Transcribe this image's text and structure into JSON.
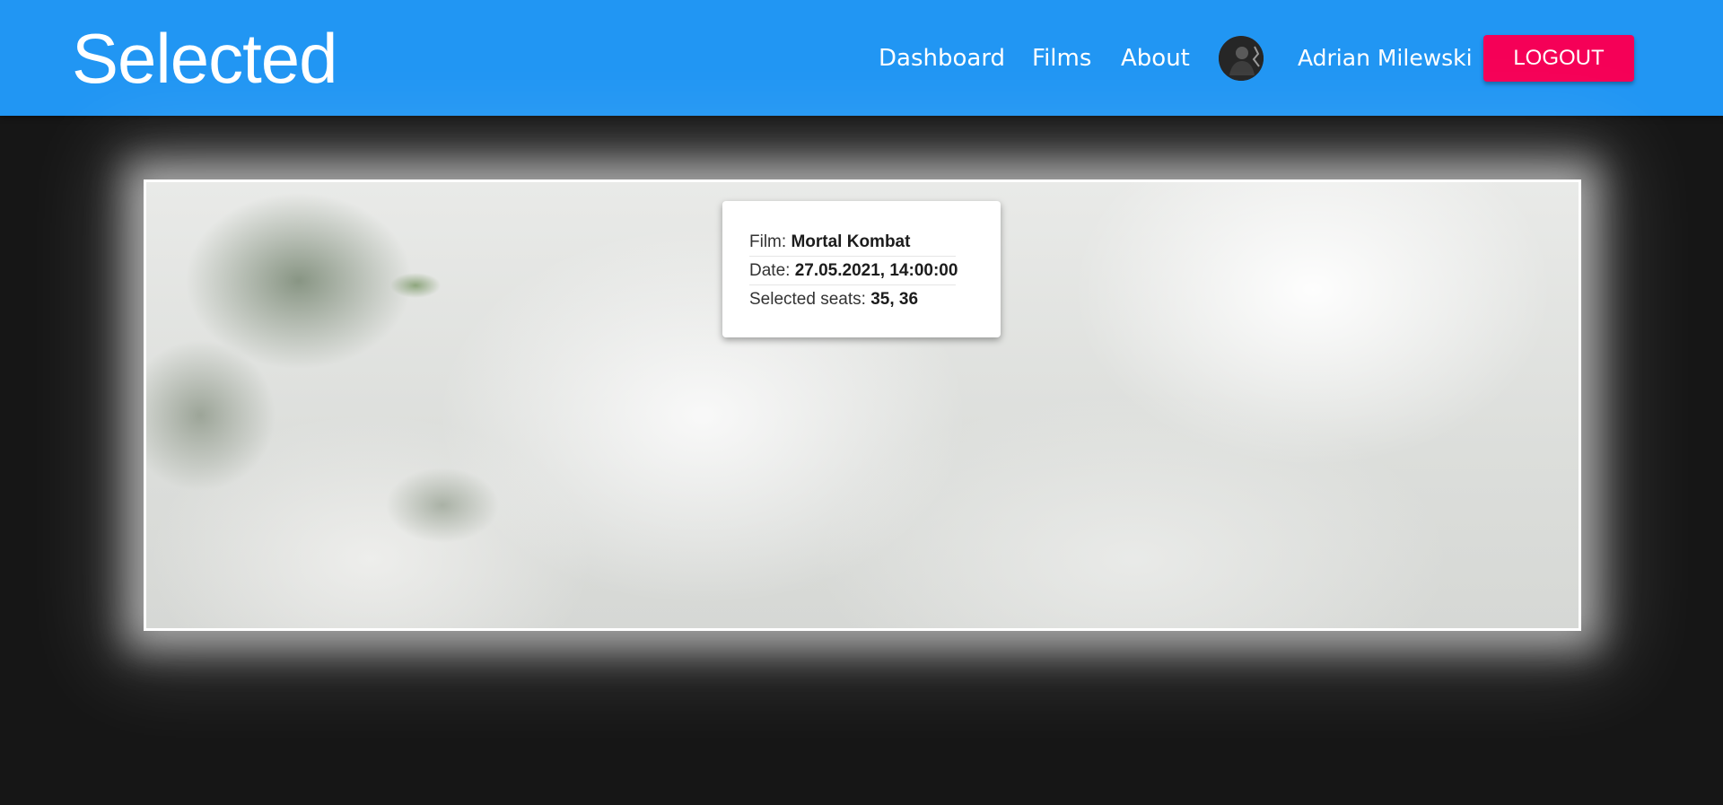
{
  "navbar": {
    "brand": "Selected",
    "links": [
      "Dashboard",
      "Films",
      "About"
    ],
    "user": {
      "avatar_icon": "user-avatar-icon",
      "name": "Adrian Milewski"
    },
    "logout_label": "LOGOUT"
  },
  "booking": {
    "film_label": "Film:",
    "film_value": "Mortal Kombat",
    "date_label": "Date:",
    "date_value": "27.05.2021, 14:00:00",
    "seats_label": "Selected seats:",
    "seats_value": "35, 36"
  },
  "colors": {
    "navbar": "#2196f3",
    "logout": "#f50057",
    "background": "#161616"
  }
}
